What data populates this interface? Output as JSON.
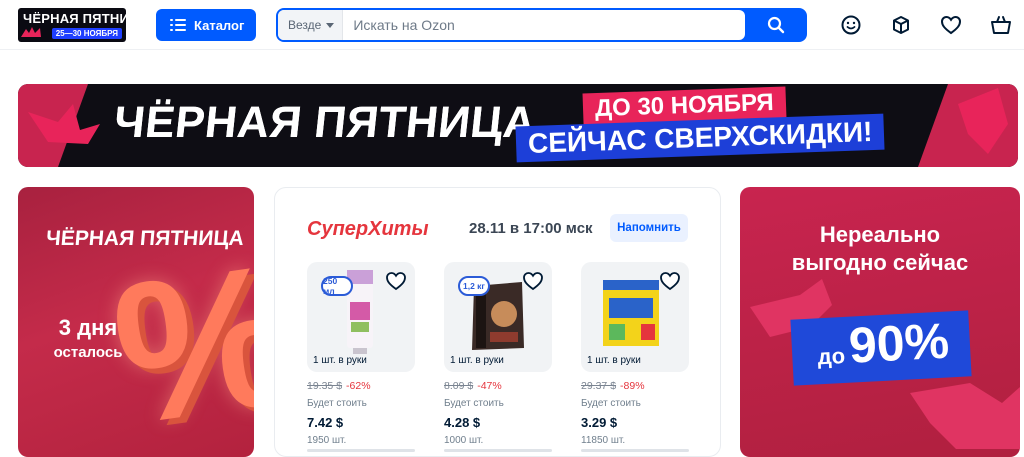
{
  "header": {
    "logo": {
      "line1": "ЧЁРНАЯ ПЯТНИЦА",
      "line2": "25—30 НОЯБРЯ"
    },
    "catalog_label": "Каталог",
    "search": {
      "scope": "Везде",
      "placeholder": "Искать на Ozon"
    },
    "icons": [
      "face-icon",
      "box-icon",
      "heart-icon",
      "cart-icon"
    ]
  },
  "banner": {
    "title": "ЧЁРНАЯ ПЯТНИЦА",
    "tag_top": "ДО 30 НОЯБРЯ",
    "tag_bottom": "СЕЙЧАС СВЕРХСКИДКИ!"
  },
  "promo_left": {
    "title": "ЧЁРНАЯ ПЯТНИЦА",
    "days": "3 дня",
    "left": "осталось",
    "symbol": "%"
  },
  "superhits": {
    "brand": "СуперХиты",
    "time": "28.11 в 17:00 мск",
    "remind_label": "Напомнить",
    "products": [
      {
        "badge": "250 мл",
        "limit": "1 шт. в руки",
        "old_price": "19.35 $",
        "discount": "-62%",
        "will_cost": "Будет стоить",
        "price": "7.42 $",
        "qty": "1950 шт."
      },
      {
        "badge": "1,2 кг",
        "limit": "1 шт. в руки",
        "old_price": "8.09 $",
        "discount": "-47%",
        "will_cost": "Будет стоить",
        "price": "4.28 $",
        "qty": "1000 шт."
      },
      {
        "badge": "",
        "limit": "1 шт. в руки",
        "old_price": "29.37 $",
        "discount": "-89%",
        "will_cost": "Будет стоить",
        "price": "3.29 $",
        "qty": "11850 шт."
      }
    ]
  },
  "promo_right": {
    "line1": "Нереально",
    "line2": "выгодно сейчас",
    "prefix": "до",
    "value": "90%"
  },
  "colors": {
    "brand_blue": "#005bff",
    "promo_red": "#c42b4a",
    "discount_red": "#e5353d"
  }
}
